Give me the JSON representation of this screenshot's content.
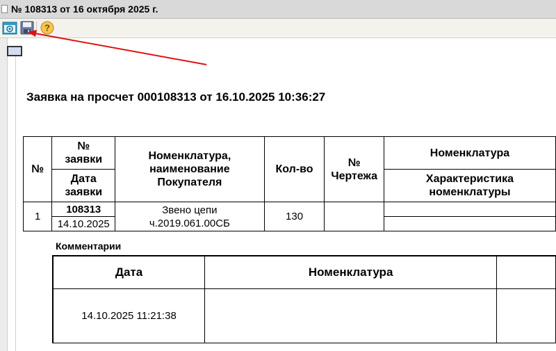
{
  "window": {
    "title": "№ 108313 от 16 октября 2025 г."
  },
  "toolbar": {
    "buttons": [
      {
        "icon": "browser-icon",
        "label": ""
      },
      {
        "icon": "save-icon",
        "label": ""
      },
      {
        "icon": "help-icon",
        "label": "?"
      }
    ]
  },
  "colors": {
    "accent_arrow": "#e01010",
    "titlebar": "#d9d9d9",
    "toolbar": "#f4f2ec"
  },
  "report": {
    "title": "Заявка на просчет 000108313 от 16.10.2025 10:36:27",
    "table": {
      "headers": {
        "num": "№",
        "order_no_l1": "№",
        "order_no_l2": "заявки",
        "order_date_l1": "Дата",
        "order_date_l2": "заявки",
        "nom_l1": "Номенклатура,",
        "nom_l2": "наименование",
        "nom_l3": "Покупателя",
        "qty": "Кол-во",
        "drawing_l1": "№",
        "drawing_l2": "Чертежа",
        "nomenclature": "Номенклатура",
        "char_l1": "Характеристика",
        "char_l2": "номенклатуры"
      },
      "rows": [
        {
          "num": "1",
          "order_no": "108313",
          "order_date": "14.10.2025",
          "nom_l1": "Звено цепи",
          "nom_l2": "ч.2019.061.00СБ",
          "qty": "130",
          "drawing": "",
          "nomenclature": "",
          "characteristic": ""
        }
      ]
    },
    "comments": {
      "label": "Комментарии",
      "headers": {
        "date": "Дата",
        "nomenclature": "Номенклатура",
        "next": ""
      },
      "rows": [
        {
          "date": "14.10.2025 11:21:38",
          "nomenclature": "",
          "next": ""
        }
      ]
    }
  }
}
